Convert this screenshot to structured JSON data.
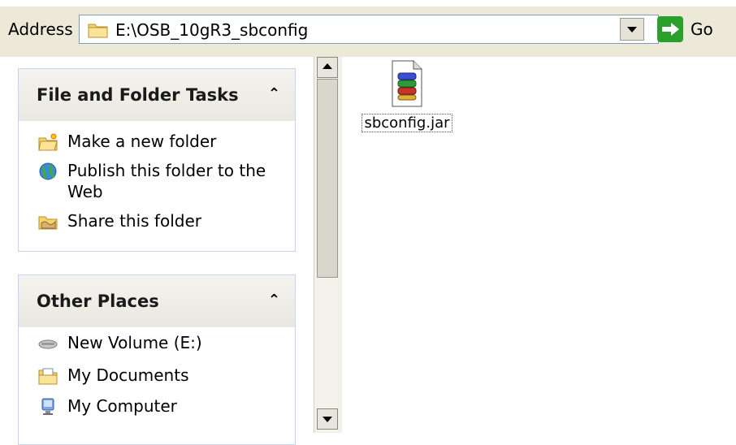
{
  "address_bar": {
    "label": "Address",
    "path": "E:\\OSB_10gR3_sbconfig",
    "go_label": "Go"
  },
  "tasks_panel": {
    "file_and_folder_tasks": {
      "title": "File and Folder Tasks",
      "collapse_glyph": "⌃",
      "items": [
        {
          "label": "Make a new folder",
          "icon": "new-folder-icon"
        },
        {
          "label": "Publish this folder to the Web",
          "icon": "publish-web-icon"
        },
        {
          "label": "Share this folder",
          "icon": "share-folder-icon"
        }
      ]
    },
    "other_places": {
      "title": "Other Places",
      "collapse_glyph": "⌃",
      "items": [
        {
          "label": "New Volume (E:)",
          "icon": "drive-icon"
        },
        {
          "label": "My Documents",
          "icon": "my-documents-icon"
        },
        {
          "label": "My Computer",
          "icon": "my-computer-icon"
        }
      ]
    }
  },
  "files": [
    {
      "name": "sbconfig.jar",
      "icon": "jar-archive-icon",
      "selected": true
    }
  ]
}
